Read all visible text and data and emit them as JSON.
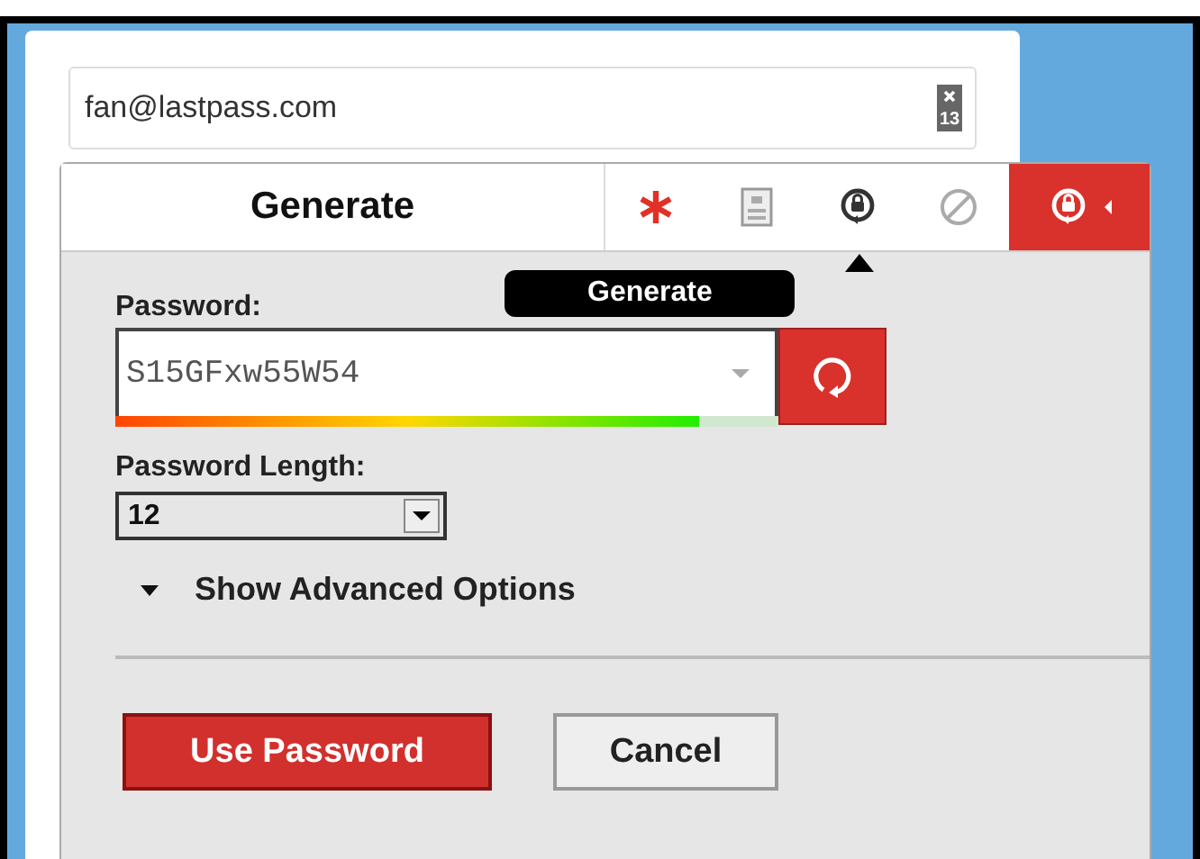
{
  "email_field": {
    "value": "fan@lastpass.com",
    "badge": "13"
  },
  "popup": {
    "title": "Generate",
    "toolbar": [
      {
        "kind": "asterisk",
        "selected": false
      },
      {
        "kind": "form",
        "selected": false
      },
      {
        "kind": "generate",
        "selected": false
      },
      {
        "kind": "never",
        "selected": false
      },
      {
        "kind": "generate",
        "selected": true
      }
    ],
    "tooltip": "Generate",
    "password": {
      "label": "Password:",
      "value": "S15GFxw55W54",
      "level": 0.88
    },
    "length": {
      "label": "Password Length:",
      "value": "12"
    },
    "advanced": {
      "label": "Show Advanced Options",
      "expanded": false
    },
    "buttons": [
      {
        "label": "Use Password",
        "kind": "primary"
      },
      {
        "label": "Cancel",
        "kind": "secondary"
      }
    ]
  }
}
